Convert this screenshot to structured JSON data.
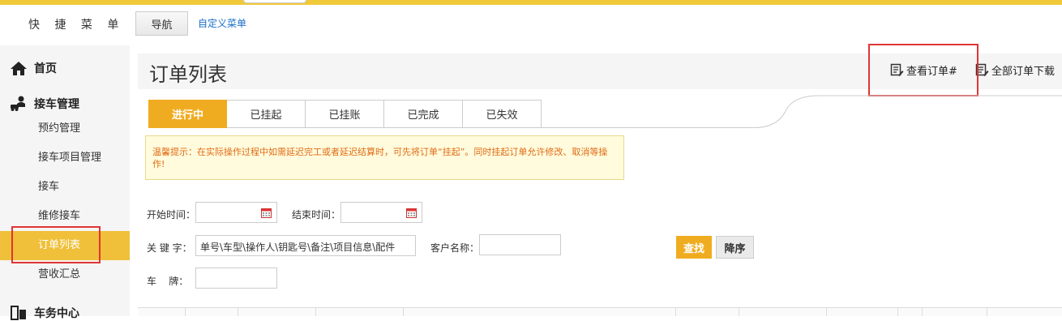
{
  "quick_menu": {
    "label": "快 捷 菜 单 ：",
    "nav_button": "导航",
    "custom_link": "自定义菜单"
  },
  "sidebar": {
    "home": "首页",
    "section_pickup": "接车管理",
    "items": [
      "预约管理",
      "接车项目管理",
      "接车",
      "维修接车",
      "订单列表",
      "营收汇总"
    ],
    "active_item": "订单列表",
    "section_next": "车务中心"
  },
  "page": {
    "title": "订单列表",
    "actions": {
      "view_orders": "查看订单#",
      "download_all": "全部订单下载"
    }
  },
  "tabs": [
    "进行中",
    "已挂起",
    "已挂账",
    "已完成",
    "已失效"
  ],
  "active_tab": "进行中",
  "notice": "温馨提示：在实际操作过程中如需延迟完工或者延迟结算时，可先将订单“挂起”。同时挂起订单允许修改、取消等操作!",
  "form": {
    "start_time_label": "开始时间：",
    "start_time_value": "",
    "end_time_label": "结束时间：",
    "end_time_value": "",
    "keyword_label": "关 键 字：",
    "keyword_placeholder": "单号\\车型\\操作人\\钥匙号\\备注\\项目信息\\配件",
    "customer_label": "客户名称：",
    "customer_value": "",
    "plate_label": "车    牌：",
    "plate_value": "",
    "search_button": "查找",
    "sort_button": "降序"
  },
  "colors": {
    "accent": "#f0ac20",
    "sidebar_active": "#f0c03a",
    "highlight_border": "#e03535",
    "notice_text": "#e06b16",
    "link": "#1a6fc9"
  }
}
